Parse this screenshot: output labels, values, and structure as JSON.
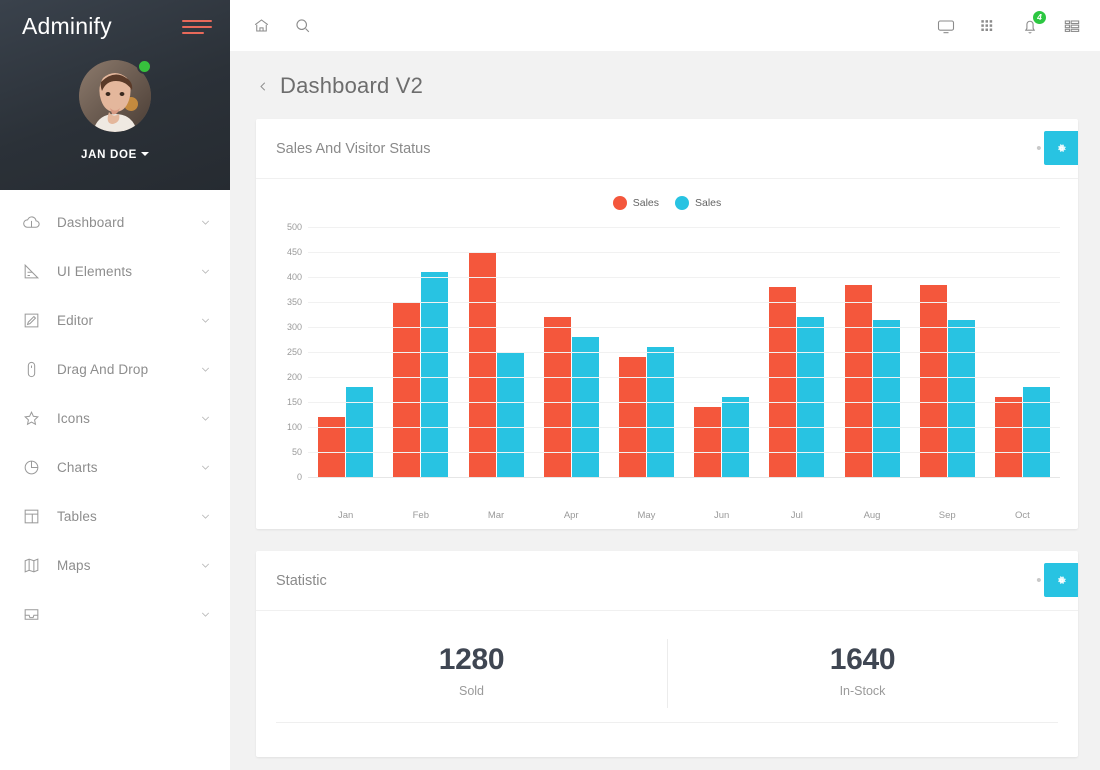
{
  "sidebar": {
    "brand": "Adminify",
    "menu_icon": "hamburger-icon",
    "user": {
      "name": "JAN DOE",
      "status": "online",
      "avatar": "user-avatar"
    },
    "items": [
      {
        "label": "Dashboard",
        "icon": "cloud-icon"
      },
      {
        "label": "UI Elements",
        "icon": "ruler-icon"
      },
      {
        "label": "Editor",
        "icon": "pencil-square-icon"
      },
      {
        "label": "Drag And Drop",
        "icon": "mouse-icon"
      },
      {
        "label": "Icons",
        "icon": "star-icon"
      },
      {
        "label": "Charts",
        "icon": "pie-chart-icon"
      },
      {
        "label": "Tables",
        "icon": "table-icon"
      },
      {
        "label": "Maps",
        "icon": "map-icon"
      },
      {
        "label": "",
        "icon": "inbox-icon"
      }
    ]
  },
  "topbar": {
    "home_icon": "home-icon",
    "search_icon": "search-icon",
    "right_icons": [
      {
        "name": "monitor-icon"
      },
      {
        "name": "grid-icon"
      },
      {
        "name": "bell-icon",
        "badge": "4"
      },
      {
        "name": "list-icon"
      }
    ]
  },
  "page": {
    "title": "Dashboard V2",
    "back_icon": "chevron-left-icon"
  },
  "cards": {
    "chart": {
      "title": "Sales And Visitor Status",
      "menu": "•••",
      "settings_icon": "gear-icon"
    },
    "statistic": {
      "title": "Statistic",
      "menu": "•••",
      "settings_icon": "gear-icon",
      "metrics": [
        {
          "value": "1280",
          "label": "Sold"
        },
        {
          "value": "1640",
          "label": "In-Stock"
        }
      ]
    }
  },
  "colors": {
    "series_red": "#f4573c",
    "series_cyan": "#28c3e2",
    "sidebar_dark": "#2f353c",
    "badge_green": "#2cc741",
    "accent_hamburger": "#e8695a"
  },
  "chart_data": {
    "type": "bar",
    "title": "Sales And Visitor Status",
    "xlabel": "",
    "ylabel": "",
    "ylim": [
      0,
      500
    ],
    "yticks": [
      0,
      50,
      100,
      150,
      200,
      250,
      300,
      350,
      400,
      450,
      500
    ],
    "grid": true,
    "legend_position": "top-center",
    "categories": [
      "Jan",
      "Feb",
      "Mar",
      "Apr",
      "May",
      "Jun",
      "Jul",
      "Aug",
      "Sep",
      "Oct"
    ],
    "series": [
      {
        "name": "Sales",
        "color": "#f4573c",
        "values": [
          120,
          350,
          450,
          320,
          240,
          140,
          380,
          385,
          385,
          160
        ]
      },
      {
        "name": "Sales",
        "color": "#28c3e2",
        "values": [
          180,
          410,
          250,
          280,
          260,
          160,
          320,
          315,
          315,
          180
        ]
      }
    ]
  }
}
